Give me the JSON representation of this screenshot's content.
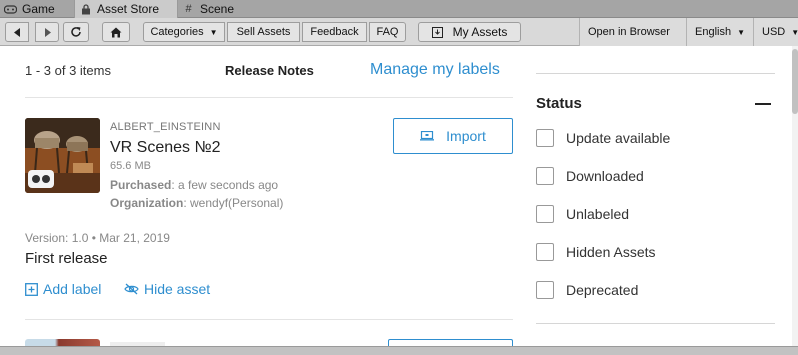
{
  "tabs": [
    {
      "label": "Game",
      "icon": "gamepad-icon"
    },
    {
      "label": "Asset Store",
      "icon": "lock-icon",
      "active": true
    },
    {
      "label": "Scene",
      "icon": "grid-icon"
    }
  ],
  "toolbar": {
    "back": "back-arrow-icon",
    "forward": "forward-arrow-icon",
    "reload": "reload-icon",
    "home": "home-icon",
    "categories": "Categories",
    "sell_assets": "Sell Assets",
    "feedback": "Feedback",
    "faq": "FAQ",
    "my_assets": "My Assets",
    "open_in_browser": "Open in Browser",
    "language": "English",
    "currency": "USD"
  },
  "list": {
    "summary": "1 - 3 of 3 items",
    "release_notes": "Release Notes",
    "manage_labels": "Manage my labels"
  },
  "asset": {
    "publisher": "ALBERT_EINSTEINN",
    "name": "VR Scenes №2",
    "size": "65.6 MB",
    "purchased_label": "Purchased",
    "purchased_value": ": a few seconds ago",
    "organization_label": "Organization",
    "organization_value": ": wendyf(Personal)",
    "import_label": "Import",
    "version": "Version: 1.0 • Mar 21, 2019",
    "release_text": "First release",
    "add_label": "Add label",
    "hide_asset": "Hide asset"
  },
  "filters": {
    "title": "Status",
    "items": [
      {
        "label": "Update available",
        "checked": false
      },
      {
        "label": "Downloaded",
        "checked": false
      },
      {
        "label": "Unlabeled",
        "checked": false
      },
      {
        "label": "Hidden Assets",
        "checked": false
      },
      {
        "label": "Deprecated",
        "checked": false
      }
    ]
  },
  "colors": {
    "accent": "#2e8ecf",
    "editor_chrome": "#c8c8c8"
  }
}
